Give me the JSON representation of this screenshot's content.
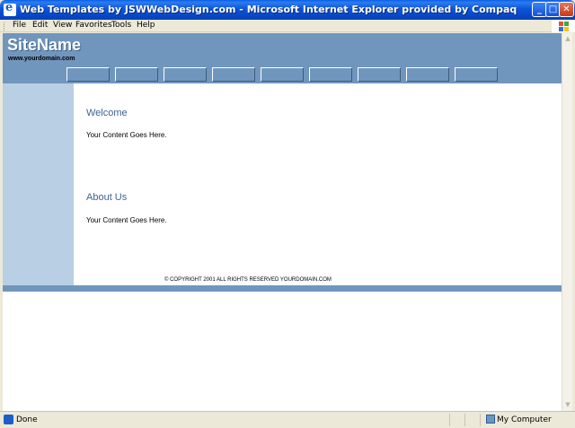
{
  "window": {
    "title": "Web Templates by JSWWebDesign.com - Microsoft Internet Explorer provided by Compaq",
    "minimize_glyph": "_",
    "maximize_glyph": "□",
    "close_glyph": "✕"
  },
  "menu": {
    "items": [
      "File",
      "Edit",
      "View",
      "Favorites",
      "Tools",
      "Help"
    ]
  },
  "page": {
    "site_name": "SiteName",
    "domain": "www.yourdomain.com",
    "nav_button_count": 9,
    "sections": [
      {
        "title": "Welcome",
        "body": "Your Content Goes Here."
      },
      {
        "title": "About Us",
        "body": "Your Content Goes Here."
      }
    ],
    "copyright": "© COPYRIGHT 2001 ALL RIGHTS RESERVED YOURDOMAIN.COM"
  },
  "status": {
    "text": "Done",
    "zone": "My Computer"
  },
  "colors": {
    "header": "#7196bd",
    "sidebar": "#b9cfe4",
    "heading": "#3f6293"
  },
  "icons": {
    "app": "internet-explorer-icon",
    "status": "page-done-icon",
    "zone": "my-computer-icon"
  }
}
